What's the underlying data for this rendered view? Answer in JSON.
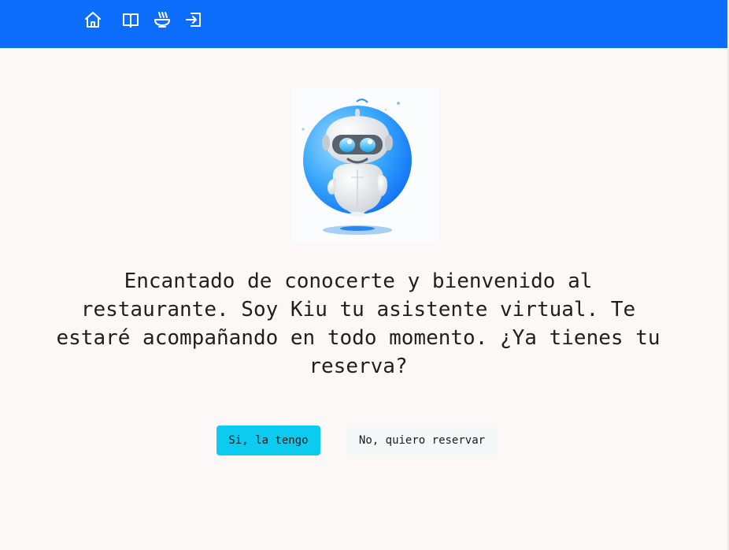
{
  "nav": {
    "icons": [
      "home-icon",
      "book-open-icon",
      "bowl-icon",
      "login-icon"
    ],
    "icon_color": "#ffffff",
    "bar_color": "#0d6efd"
  },
  "assistant": {
    "name": "Kiu",
    "avatar": "robot-illustration",
    "message": "Encantado de conocerte y bienvenido al restaurante. Soy Kiu tu asistente virtual. Te estaré acompañando en todo momento. ¿Ya tienes tu reserva?"
  },
  "actions": {
    "yes_label": "Si, la tengo",
    "no_label": "No, quiero reservar",
    "yes_color": "#0dcaf0"
  }
}
